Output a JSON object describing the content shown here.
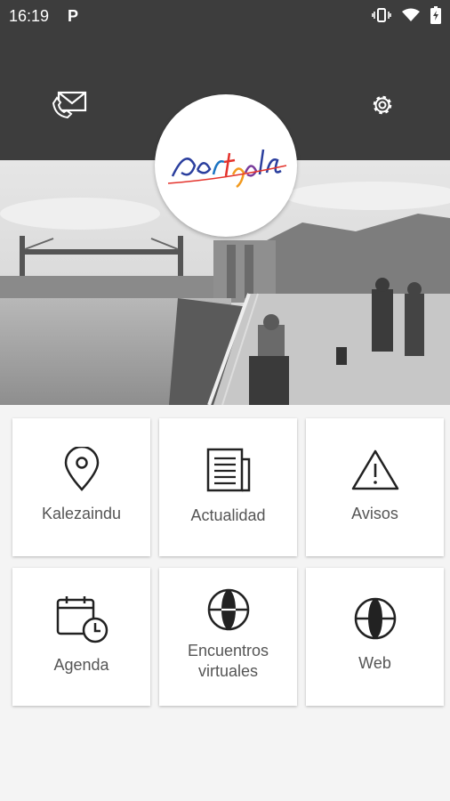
{
  "status_bar": {
    "time": "16:19",
    "app_badge": "P",
    "icons": [
      "vibrate-icon",
      "wifi-icon",
      "battery-charging-icon"
    ]
  },
  "header": {
    "icons": [
      "contact-mail-icon",
      "gear-icon"
    ],
    "logo_text": "Portugalete"
  },
  "menu": {
    "items": [
      {
        "label": "Kalezaindu",
        "icon": "map-pin-icon"
      },
      {
        "label": "Actualidad",
        "icon": "newspaper-icon"
      },
      {
        "label": "Avisos",
        "icon": "warning-icon"
      },
      {
        "label": "Agenda",
        "icon": "calendar-clock-icon"
      },
      {
        "label": "Encuentros\nvirtuales",
        "icon": "globe-icon"
      },
      {
        "label": "Web",
        "icon": "globe-icon"
      }
    ]
  },
  "colors": {
    "header_bg": "#3d3d3d",
    "tile_bg": "#ffffff",
    "page_bg": "#f4f4f4",
    "label": "#555555",
    "icon": "#222222"
  }
}
